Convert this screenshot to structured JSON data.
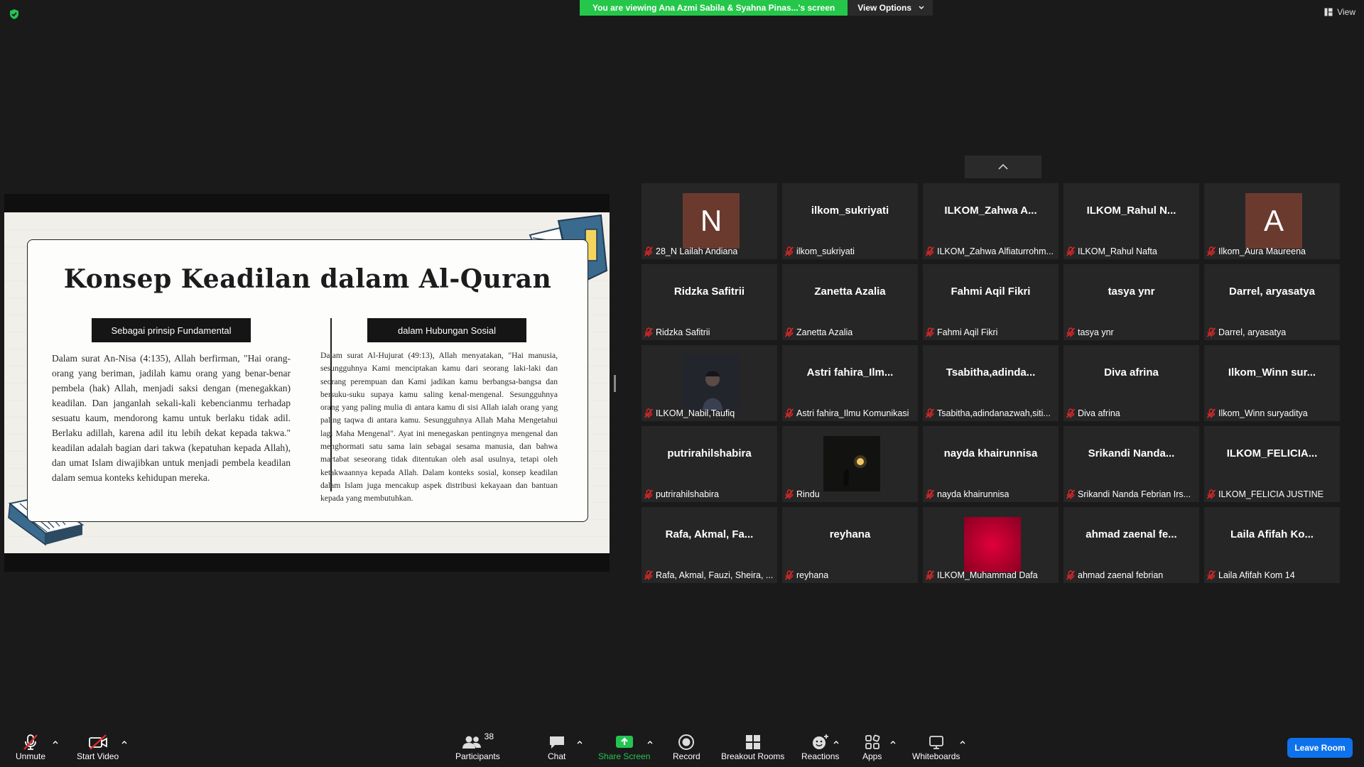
{
  "banner": {
    "message": "You are viewing Ana Azmi Sabila & Syahna Pinas...'s screen",
    "view_options": "View Options"
  },
  "top_right": {
    "view_label": "View"
  },
  "slide": {
    "title": "Konsep Keadilan dalam Al-Quran",
    "left_heading": "Sebagai prinsip Fundamental",
    "right_heading": "dalam Hubungan Sosial",
    "left_text": "Dalam surat An-Nisa (4:135), Allah berfirman, \"Hai orang-orang yang beriman, jadilah kamu orang yang benar-benar pembela (hak) Allah, menjadi saksi dengan (menegakkan) keadilan. Dan janganlah sekali-kali kebencianmu terhadap sesuatu kaum, mendorong kamu untuk berlaku tidak adil. Berlaku adillah, karena adil itu lebih dekat kepada takwa.\" keadilan adalah bagian dari takwa (kepatuhan kepada Allah), dan umat Islam diwajibkan untuk menjadi pembela keadilan dalam semua konteks kehidupan mereka.",
    "right_text": "Dalam surat Al-Hujurat (49:13), Allah menyatakan, \"Hai manusia, sesungguhnya Kami menciptakan kamu dari seorang laki-laki dan seorang perempuan dan Kami jadikan kamu berbangsa-bangsa dan bersuku-suku supaya kamu saling kenal-mengenal. Sesungguhnya orang yang paling mulia di antara kamu di sisi Allah ialah orang yang paling taqwa di antara kamu. Sesungguhnya Allah Maha Mengetahui lagi Maha Mengenal\". Ayat ini menegaskan pentingnya mengenal dan menghormati satu sama lain sebagai sesama manusia, dan bahwa martabat seseorang tidak ditentukan oleh asal usulnya, tetapi oleh ketakwaannya kepada Allah. Dalam konteks sosial, konsep keadilan dalam Islam juga mencakup aspek distribusi kekayaan dan bantuan kepada yang membutuhkan."
  },
  "participants": [
    {
      "big": "",
      "foot": "28_N Lailah Andiana",
      "avatar": "N",
      "avatar_color": "#6b3a2e"
    },
    {
      "big": "ilkom_sukriyati",
      "foot": "ilkom_sukriyati"
    },
    {
      "big": "ILKOM_Zahwa A...",
      "foot": "ILKOM_Zahwa Alfiaturrohm..."
    },
    {
      "big": "ILKOM_Rahul N...",
      "foot": "ILKOM_Rahul Nafta"
    },
    {
      "big": "",
      "foot": "Ilkom_Aura Maureena",
      "avatar": "A",
      "avatar_color": "#6b3a2e"
    },
    {
      "big": "Ridzka Safitrii",
      "foot": "Ridzka Safitrii"
    },
    {
      "big": "Zanetta Azalia",
      "foot": "Zanetta Azalia"
    },
    {
      "big": "Fahmi Aqil Fikri",
      "foot": "Fahmi Aqil Fikri"
    },
    {
      "big": "tasya ynr",
      "foot": "tasya ynr"
    },
    {
      "big": "Darrel, aryasatya",
      "foot": "Darrel, aryasatya"
    },
    {
      "big": "",
      "foot": "ILKOM_Nabil,Taufiq",
      "photo": "person"
    },
    {
      "big": "Astri fahira_Ilm...",
      "foot": "Astri fahira_Ilmu Komunikasi"
    },
    {
      "big": "Tsabitha,adinda...",
      "foot": "Tsabitha,adindanazwah,siti..."
    },
    {
      "big": "Diva afrina",
      "foot": "Diva afrina"
    },
    {
      "big": "Ilkom_Winn sur...",
      "foot": "Ilkom_Winn suryaditya"
    },
    {
      "big": "putrirahilshabira",
      "foot": "putrirahilshabira"
    },
    {
      "big": "",
      "foot": "Rindu",
      "photo": "moon"
    },
    {
      "big": "nayda khairunnisa",
      "foot": "nayda khairunnisa"
    },
    {
      "big": "Srikandi Nanda...",
      "foot": "Srikandi Nanda Febrian Irs..."
    },
    {
      "big": "ILKOM_FELICIA...",
      "foot": "ILKOM_FELICIA JUSTINE"
    },
    {
      "big": "Rafa, Akmal, Fa...",
      "foot": "Rafa, Akmal, Fauzi, Sheira, ..."
    },
    {
      "big": "reyhana",
      "foot": "reyhana"
    },
    {
      "big": "",
      "foot": "ILKOM_Muhammad Dafa",
      "photo": "red"
    },
    {
      "big": "ahmad zaenal fe...",
      "foot": "ahmad zaenal febrian"
    },
    {
      "big": "Laila Afifah Ko...",
      "foot": "Laila Afifah Kom 14"
    }
  ],
  "toolbar": {
    "unmute": "Unmute",
    "start_video": "Start Video",
    "participants": "Participants",
    "participants_count": "38",
    "chat": "Chat",
    "share_screen": "Share Screen",
    "record": "Record",
    "breakout_rooms": "Breakout Rooms",
    "reactions": "Reactions",
    "apps": "Apps",
    "whiteboards": "Whiteboards",
    "leave_room": "Leave Room"
  },
  "colors": {
    "share_green": "#23c552",
    "leave_blue": "#0e72ed",
    "muted_red": "#e02828"
  }
}
